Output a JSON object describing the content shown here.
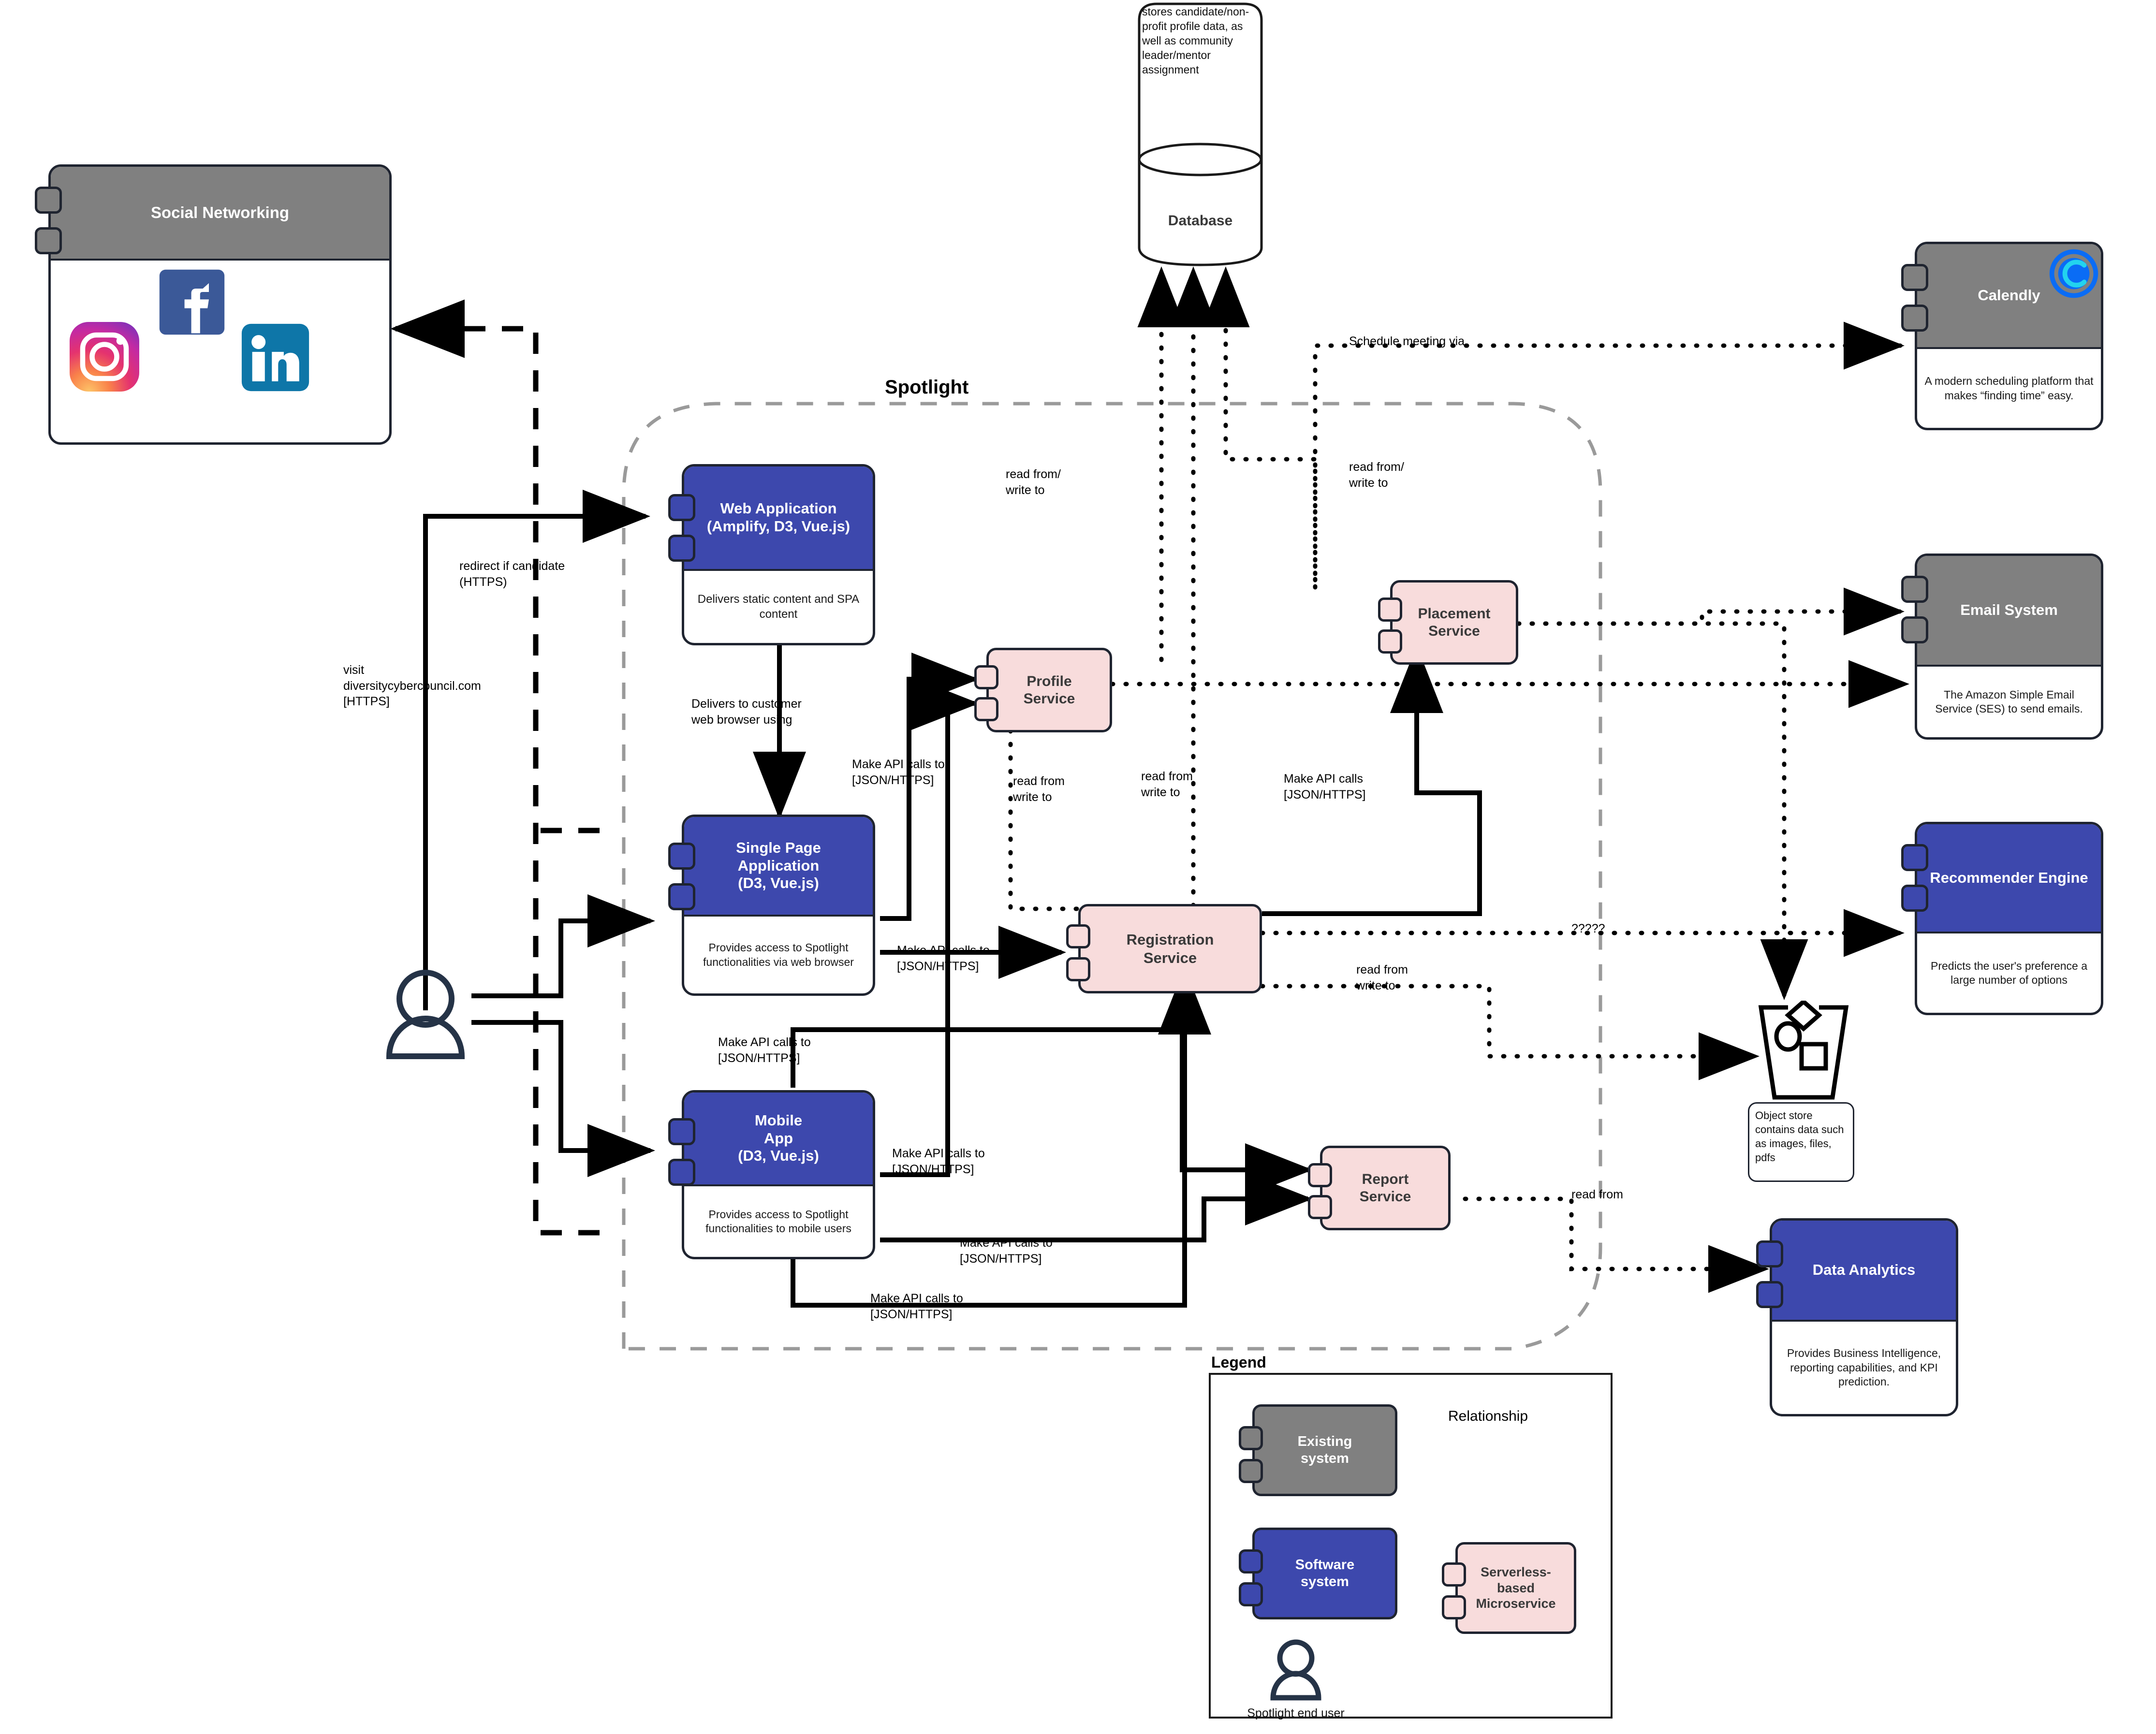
{
  "diagram": {
    "boundary_label": "Spotlight"
  },
  "database": {
    "note": "stores candidate/non-profit profile data, as well as community leader/mentor assignment",
    "title": "Database"
  },
  "external_systems": [
    {
      "id": "social-networking",
      "title": "Social Networking",
      "desc": "",
      "kind": "existing",
      "logos": [
        "instagram-logo",
        "facebook-logo",
        "linkedin-logo"
      ]
    },
    {
      "id": "calendly",
      "title": "Calendly",
      "desc": "A modern scheduling platform that makes “finding time” easy.",
      "kind": "existing"
    },
    {
      "id": "email-system",
      "title": "Email System",
      "desc": "The Amazon Simple Email Service (SES) to send emails.",
      "kind": "existing"
    },
    {
      "id": "recommender-engine",
      "title": "Recommender Engine",
      "desc": "Predicts the user's preference  a large number of options",
      "kind": "software"
    },
    {
      "id": "data-analytics",
      "title": "Data Analytics",
      "desc": "Provides Business Intelligence, reporting capabilities, and KPI prediction.",
      "kind": "software"
    }
  ],
  "containers": [
    {
      "id": "web-application",
      "title": "Web Application\n(Amplify, D3, Vue.js)",
      "desc": "Delivers static content and SPA content",
      "kind": "software"
    },
    {
      "id": "single-page-application",
      "title": "Single Page\nApplication\n(D3, Vue.js)",
      "desc": "Provides access to Spotlight functionalities via web browser",
      "kind": "software"
    },
    {
      "id": "mobile-app",
      "title": "Mobile\nApp\n(D3, Vue.js)",
      "desc": "Provides access to Spotlight functionalities to mobile users",
      "kind": "software"
    }
  ],
  "microservices": [
    {
      "id": "profile-service",
      "title": "Profile\nService"
    },
    {
      "id": "placement-service",
      "title": "Placement\nService"
    },
    {
      "id": "registration-service",
      "title": "Registration\nService"
    },
    {
      "id": "report-service",
      "title": "Report\nService"
    }
  ],
  "object_store": {
    "note": "Object store contains data such as images, files, pdfs"
  },
  "edge_labels": {
    "visit_site": "visit\ndiversitycybercouncil.com\n[HTTPS]",
    "redirect_candidate": "redirect if candidate\n(HTTPS)",
    "delivers_browser": "Delivers to customer\nweb browser using",
    "api_spa_profile": "Make API calls to\n[JSON/HTTPS]",
    "api_spa_registration": "Make API calls to\n[JSON/HTTPS]",
    "api_mobile_profile": "Make API calls to\n[JSON/HTTPS]",
    "api_mobile_report": "Make API calls to\n[JSON/HTTPS]",
    "api_mobile_registration": "Make API calls to\n[JSON/HTTPS]",
    "api_registration_placement": "Make API calls\n[JSON/HTTPS]",
    "db_profile": "read from/\nwrite to",
    "db_placement": "read from/\nwrite to",
    "db_profile_down": "read from\nwrite to",
    "db_registration_down": "read from\nwrite to",
    "db_registration_store": "read from\nwrite to",
    "schedule_meeting": "Schedule meeting via",
    "unknown_relationship": "?????",
    "report_read_from": "read from"
  },
  "legend": {
    "title": "Legend",
    "existing_system": "Existing\nsystem",
    "software_system": "Software\nsystem",
    "microservice": "Serverless-\nbased\nMicroservice",
    "relationship_title": "Relationship",
    "end_user": "Spotlight end user"
  },
  "colors": {
    "existing_system": "#808080",
    "software_system": "#3d48ad",
    "microservice": "#f8dcdc",
    "stroke": "#1f2430",
    "person": "#253347",
    "boundary": "#9a9a9a"
  }
}
